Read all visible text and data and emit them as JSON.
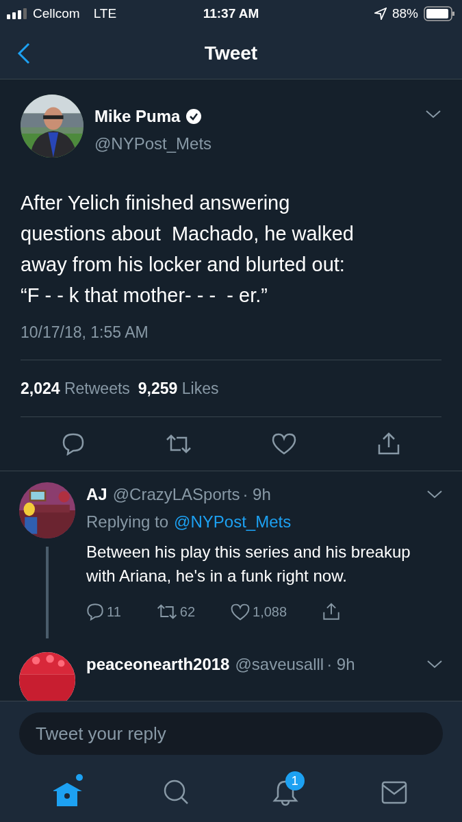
{
  "status_bar": {
    "carrier": "Cellcom",
    "network": "LTE",
    "time": "11:37 AM",
    "battery": "88%"
  },
  "nav": {
    "title": "Tweet"
  },
  "tweet": {
    "name": "Mike Puma",
    "verified": true,
    "handle": "@NYPost_Mets",
    "text": "After Yelich finished answering\nquestions about  Machado, he walked\naway from his locker and blurted out:\n“F - - k that mother- - -  - er.”",
    "timestamp": "10/17/18, 1:55 AM",
    "retweets": "2,024",
    "retweets_label": "Retweets",
    "likes": "9,259",
    "likes_label": "Likes"
  },
  "replies": [
    {
      "name": "AJ",
      "handle": "@CrazyLASports",
      "time": "· 9h",
      "replying_label": "Replying to",
      "replying_to": "@NYPost_Mets",
      "text": "Between his play this series and his breakup with Ariana, he's in a funk right now.",
      "replies": "11",
      "retweets": "62",
      "likes": "1,088",
      "thread": true
    },
    {
      "name": "peaceonearth2018",
      "handle": "@saveusalll",
      "time": "· 9h",
      "thread": false
    }
  ],
  "compose": {
    "placeholder": "Tweet your reply"
  },
  "tab_bar": [
    {
      "kind": "home",
      "selected": true,
      "dot": true
    },
    {
      "kind": "search",
      "selected": false,
      "dot": false
    },
    {
      "kind": "notifications",
      "selected": false,
      "dot": false,
      "badge": "1"
    },
    {
      "kind": "messages",
      "selected": false,
      "dot": false
    }
  ]
}
